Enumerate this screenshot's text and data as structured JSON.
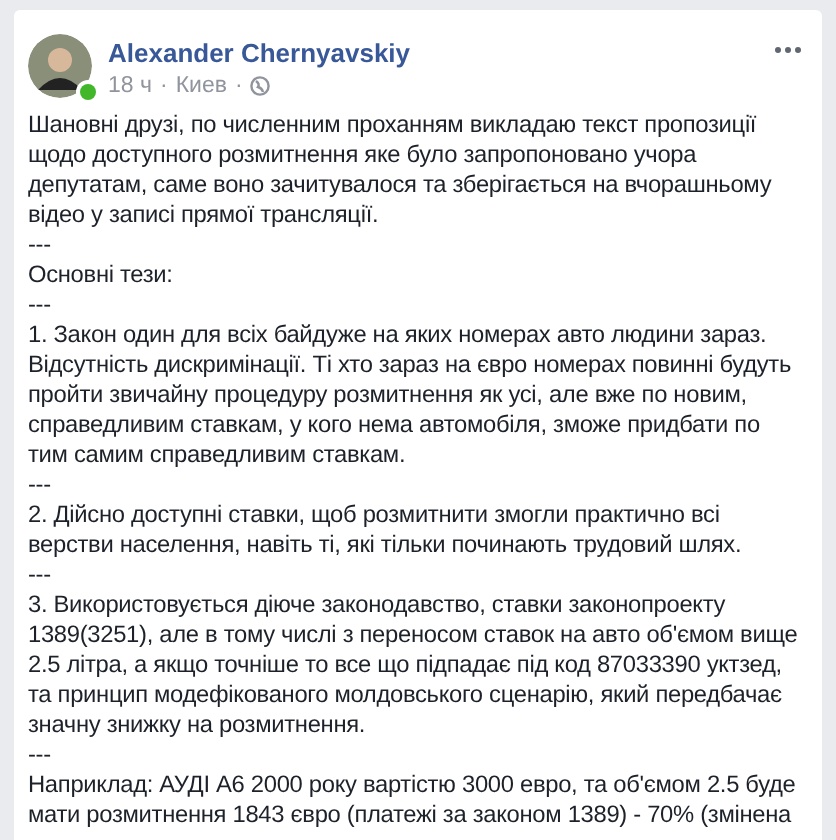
{
  "post": {
    "author": "Alexander Chernyavskiy",
    "online": true,
    "time": "18 ч",
    "separator": "·",
    "location": "Киев",
    "body": [
      "Шановні друзі, по численним проханням викладаю текст пропозиції щодо доступного розмитнення яке було запропоновано учора депутатам, саме воно зачитувалося та зберігається на вчорашньому відео у записі прямої трансляції.",
      "---",
      "Основні тези:",
      "---",
      "1. Закон один для всіх байдуже на яких номерах авто людини зараз. Відсутність дискримінації. Ті хто зараз на євро номерах повинні будуть пройти звичайну процедуру розмитнення як усі, але вже по новим, справедливим ставкам, у кого нема автомобіля, зможе придбати по тим самим справедливим ставкам.",
      "---",
      "2. Дійсно доступні ставки, щоб розмитнити змогли практично всі верстви населення, навіть ті, які тільки починають трудовий шлях.",
      "---",
      "3. Використовується діюче законодавство, ставки законопроекту 1389(3251), але в тому числі з переносом ставок на авто об'ємом вище 2.5 літра, а якщо точніше то все що підпадає під код 87033390 уктзед, та принцип модефікованого молдовського сценарію, який передбачає значну знижку на розмитнення.",
      "---",
      "Наприклад: АУДІ А6 2000 року вартістю 3000 евро, та об'ємом 2.5 буде мати розмитнення 1843 євро (платежі за законом 1389) - 70% (змінена"
    ]
  }
}
